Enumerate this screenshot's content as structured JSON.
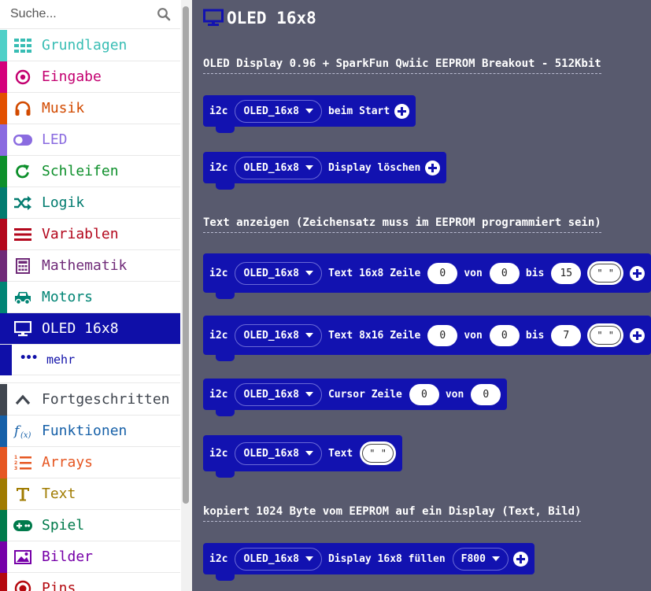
{
  "search": {
    "placeholder": "Suche..."
  },
  "sidebar": {
    "categories": [
      {
        "label": "Grundlagen",
        "color": "#1e90ff",
        "stripe": "#4fd0c8",
        "labelColor": "#38bdb4",
        "icon": "grid-icon"
      },
      {
        "label": "Eingabe",
        "color": "#d4007b",
        "labelColor": "#c30070",
        "icon": "target-icon"
      },
      {
        "label": "Musik",
        "color": "#e25000",
        "labelColor": "#d24a00",
        "icon": "headphones-icon"
      },
      {
        "label": "LED",
        "color": "#8a6be0",
        "labelColor": "#8a6be0",
        "icon": "toggle-icon"
      },
      {
        "label": "Schleifen",
        "color": "#0c8f2a",
        "labelColor": "#0c8f2a",
        "icon": "loop-icon"
      },
      {
        "label": "Logik",
        "color": "#017b6f",
        "labelColor": "#017b6f",
        "icon": "shuffle-icon"
      },
      {
        "label": "Variablen",
        "color": "#b3071c",
        "labelColor": "#b3071c",
        "icon": "bars-icon"
      },
      {
        "label": "Mathematik",
        "color": "#6f2a78",
        "labelColor": "#6f2a78",
        "icon": "calculator-icon"
      },
      {
        "label": "Motors",
        "color": "#008474",
        "labelColor": "#008474",
        "icon": "car-icon"
      },
      {
        "label": "OLED 16x8",
        "color": "#0f0fa8",
        "labelColor": "#ffffff",
        "icon": "monitor-icon",
        "selected": true
      }
    ],
    "more_label": "mehr",
    "advanced": [
      {
        "label": "Fortgeschritten",
        "color": "#40464f",
        "labelColor": "#40464f",
        "icon": "chevron-up-icon"
      },
      {
        "label": "Funktionen",
        "color": "#1660a8",
        "labelColor": "#1660a8",
        "icon": "function-icon"
      },
      {
        "label": "Arrays",
        "color": "#e65722",
        "labelColor": "#e65722",
        "icon": "numbered-list-icon"
      },
      {
        "label": "Text",
        "color": "#a07b00",
        "labelColor": "#a07b00",
        "icon": "text-icon"
      },
      {
        "label": "Spiel",
        "color": "#007a4b",
        "labelColor": "#007a4b",
        "icon": "gamepad-icon"
      },
      {
        "label": "Bilder",
        "color": "#7600a8",
        "labelColor": "#7600a8",
        "icon": "image-icon"
      },
      {
        "label": "Pins",
        "color": "#b4090f",
        "labelColor": "#b4090f",
        "icon": "pin-icon"
      }
    ]
  },
  "flyout": {
    "title": "OLED 16x8",
    "headings": [
      "OLED Display 0.96 + SparkFun Qwiic EEPROM Breakout - 512Kbit",
      "Text anzeigen (Zeichensatz muss im EEPROM programmiert sein)",
      "kopiert 1024 Byte vom EEPROM auf ein Display (Text, Bild)"
    ],
    "blocks": {
      "start": {
        "i2c": "i2c",
        "device": "OLED_16x8",
        "text": "beim Start"
      },
      "clear": {
        "i2c": "i2c",
        "device": "OLED_16x8",
        "text": "Display löschen"
      },
      "text16": {
        "i2c": "i2c",
        "device": "OLED_16x8",
        "text": "Text 16x8 Zeile",
        "row": "0",
        "von": "von",
        "col_from": "0",
        "bis": "bis",
        "col_to": "15",
        "str": "\" \""
      },
      "text8": {
        "i2c": "i2c",
        "device": "OLED_16x8",
        "text": "Text 8x16 Zeile",
        "row": "0",
        "von": "von",
        "col_from": "0",
        "bis": "bis",
        "col_to": "7",
        "str": "\" \""
      },
      "cursor": {
        "i2c": "i2c",
        "device": "OLED_16x8",
        "text": "Cursor Zeile",
        "row": "0",
        "von": "von",
        "col": "0"
      },
      "text": {
        "i2c": "i2c",
        "device": "OLED_16x8",
        "text": "Text",
        "str": "\" \""
      },
      "fill": {
        "i2c": "i2c",
        "device": "OLED_16x8",
        "text": "Display 16x8 füllen",
        "addr": "F800"
      }
    }
  }
}
